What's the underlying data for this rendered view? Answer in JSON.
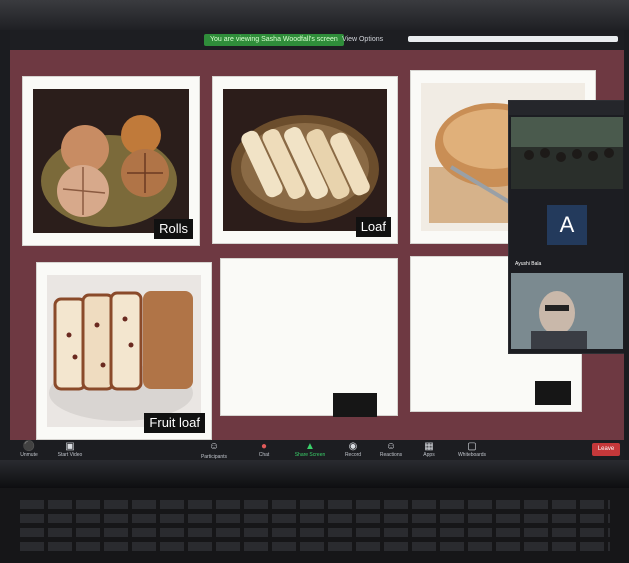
{
  "topbar": {
    "meeting_title": "",
    "sharing_notice": "You are viewing Sasha Woodfall's screen",
    "view_options": "View Options"
  },
  "slide": {
    "cards": [
      {
        "label": "Rolls"
      },
      {
        "label": "Loaf"
      },
      {
        "label": ""
      },
      {
        "label": "Fruit loaf"
      },
      {
        "label": ""
      },
      {
        "label": ""
      }
    ]
  },
  "participants": {
    "tile1_name": "",
    "tile2_letter": "A",
    "tile2_name": "Ayushi Bala",
    "tile3_name": ""
  },
  "toolbar": {
    "unmute": "Unmute",
    "start_video": "Start Video",
    "participants": "Participants",
    "participants_count": "",
    "chat": "Chat",
    "share_screen": "Share Screen",
    "record": "Record",
    "reactions": "Reactions",
    "apps": "Apps",
    "whiteboards": "Whiteboards",
    "leave": "Leave"
  },
  "colors": {
    "slide_bg": "#6e3942",
    "sharing_green": "#2f8d3a",
    "leave_red": "#c5383a"
  }
}
